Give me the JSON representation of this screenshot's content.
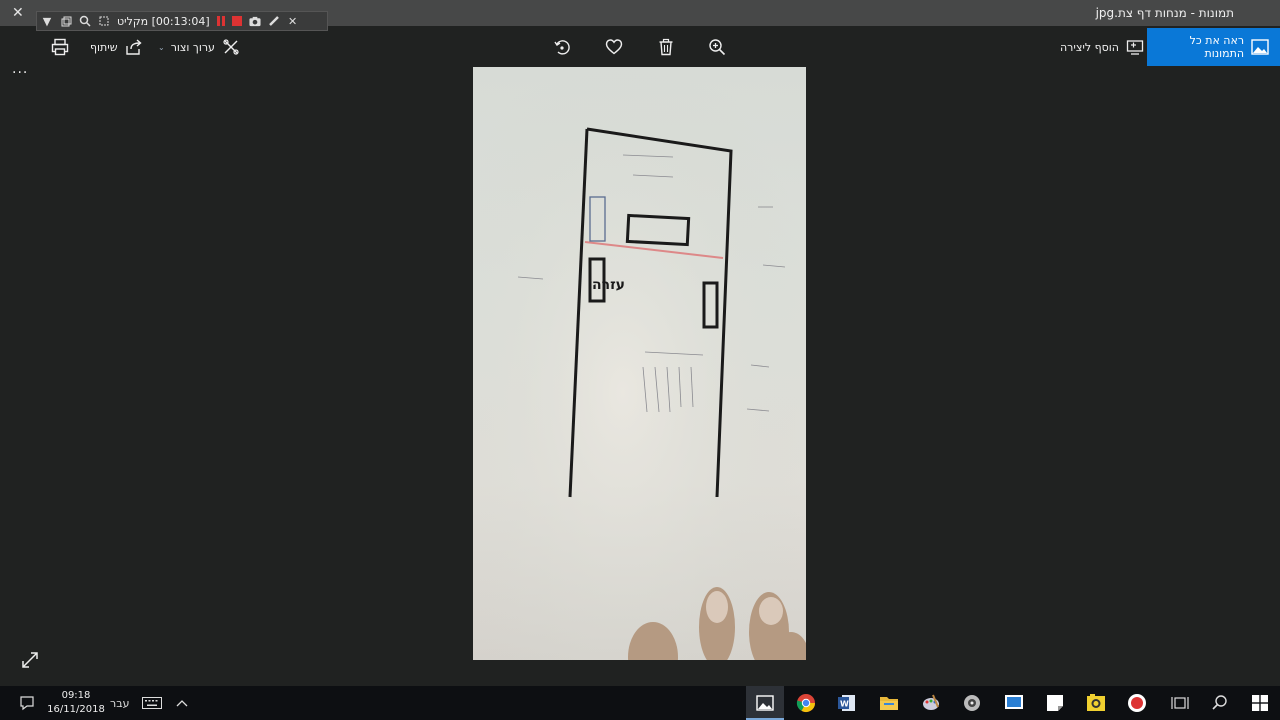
{
  "window": {
    "title": "תמונות - מנחות דף צת.jpg"
  },
  "recorder": {
    "timer": "[00:13:04] מקליט"
  },
  "toolbar": {
    "see_all_label": "ראה את כל התמונות",
    "add_to_creation_label": "הוסף ליצירה",
    "edit_create_label": "ערוך וצור",
    "share_label": "שיתוף",
    "more_label": "···"
  },
  "taskbar": {
    "time": "09:18",
    "date": "16/11/2018",
    "language": "עבר"
  },
  "photo": {
    "sketch_word": "עזרה"
  },
  "colors": {
    "accent": "#0a78d7",
    "record_red": "#d33333"
  }
}
